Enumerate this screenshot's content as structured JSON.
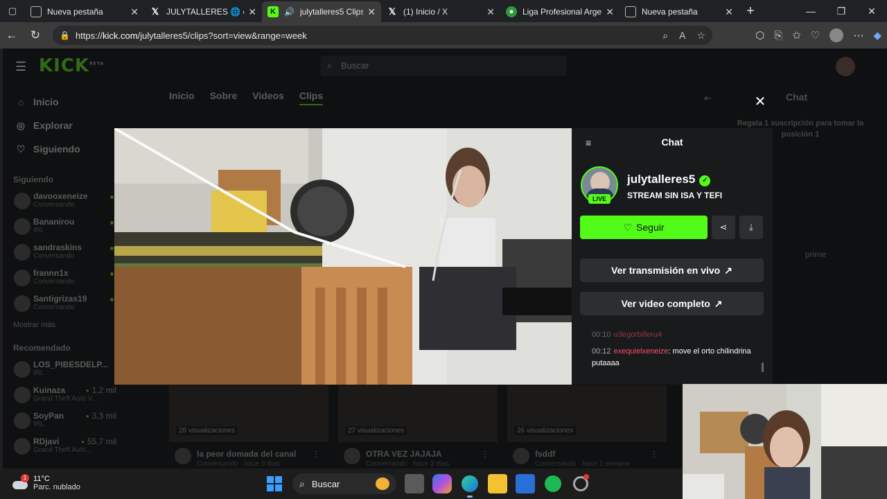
{
  "browser": {
    "tabs": [
      {
        "title": "Nueva pestaña",
        "favicon": "blank-page-icon",
        "active": false
      },
      {
        "title": "JULYTALLERES 🌐 en X",
        "favicon": "x-logo-icon",
        "active": false
      },
      {
        "title": "julytalleres5 Clips",
        "favicon": "kick-logo-icon",
        "active": true,
        "audio": true
      },
      {
        "title": "(1) Inicio / X",
        "favicon": "x-logo-icon",
        "active": false
      },
      {
        "title": "Liga Profesional Argen",
        "favicon": "globe-icon",
        "active": false
      },
      {
        "title": "Nueva pestaña",
        "favicon": "blank-page-icon",
        "active": false
      }
    ],
    "new_tab": "+",
    "url_prefix": "https://",
    "url_domain": "kick.com",
    "url_path": "/julytalleres5/clips?sort=view&range=week"
  },
  "kick": {
    "logo": "KICK",
    "logo_sup": "BETA",
    "search_placeholder": "Buscar",
    "nav": [
      {
        "label": "Inicio",
        "icon": "home-icon"
      },
      {
        "label": "Explorar",
        "icon": "compass-icon"
      },
      {
        "label": "Siguiendo",
        "icon": "heart-icon"
      }
    ],
    "following_title": "Siguiendo",
    "following": [
      {
        "name": "davooxeneize",
        "status": "Conversando"
      },
      {
        "name": "Bananirou",
        "status": "IRL"
      },
      {
        "name": "sandraskins",
        "status": "Conversando"
      },
      {
        "name": "frannn1x",
        "status": "Conversando"
      },
      {
        "name": "Santigrizas19",
        "status": "Conversando"
      }
    ],
    "show_more": "Mostrar más",
    "recommended_title": "Recomendado",
    "recommended": [
      {
        "name": "LOS_PIBESDELP...",
        "status": "IRL",
        "viewers": ""
      },
      {
        "name": "Kuinaza",
        "status": "Grand Theft Auto V...",
        "viewers": "1,2 mil"
      },
      {
        "name": "SoyPan",
        "status": "IRL",
        "viewers": "3,3 mil"
      },
      {
        "name": "RDjavi",
        "status": "Grand Theft Auto...",
        "viewers": "55,7 mil"
      }
    ],
    "channel_tabs": [
      "Inicio",
      "Sobre",
      "Videos",
      "Clips"
    ],
    "bg_chat_title": "Chat",
    "bg_promo": "Regala 1 suscripción para tomar la posición 1",
    "bg_prime": "prime",
    "clips": [
      {
        "views": "28 visualizaciones",
        "title": "la peor domada del canal",
        "sub": "Conversando · hace 3 días"
      },
      {
        "views": "27 visualizaciones",
        "title": "OTRA VEZ JAJAJA",
        "sub": "Conversando · hace 3 días"
      },
      {
        "views": "26 visualizaciones",
        "title": "fsddf",
        "sub": "Conversando · hace 1 semana"
      }
    ]
  },
  "modal": {
    "chat_title": "Chat",
    "streamer": "julytalleres5",
    "live_label": "LIVE",
    "stream_title": "STREAM SIN ISA Y TEFI",
    "follow_label": "Seguir",
    "live_button": "Ver transmisión en vivo",
    "full_video_button": "Ver video completo",
    "chat_messages": [
      {
        "time": "00:10",
        "user": "u3egorbilleru4",
        "text": ""
      },
      {
        "time": "00:12",
        "user": "exequielxeneize",
        "text": "move el orto chilindrina putaaaa"
      }
    ]
  },
  "taskbar": {
    "temperature": "11°C",
    "weather": "Parc. nublado",
    "weather_badge": "1",
    "search_label": "Buscar"
  },
  "colors": {
    "kick_green": "#53fc18",
    "chat_user": "#ff4d6d"
  }
}
